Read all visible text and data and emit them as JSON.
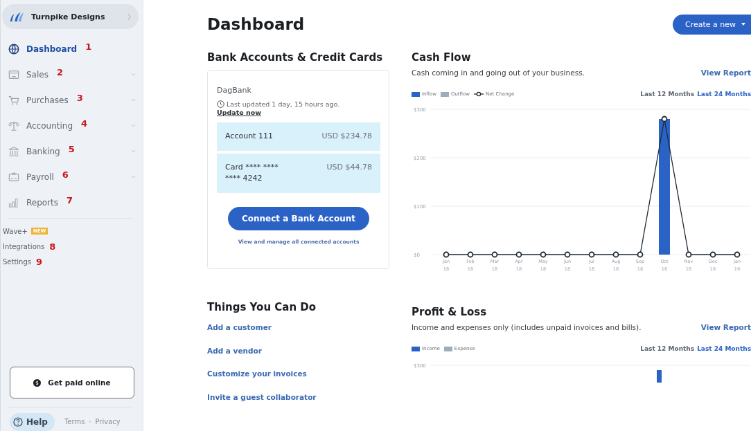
{
  "sidebar": {
    "business": {
      "name": "Turnpike Designs"
    },
    "items": [
      {
        "label": "Dashboard",
        "selected": true,
        "expandable": false,
        "annotation": "1"
      },
      {
        "label": "Sales",
        "selected": false,
        "expandable": true,
        "annotation": "2"
      },
      {
        "label": "Purchases",
        "selected": false,
        "expandable": true,
        "annotation": "3"
      },
      {
        "label": "Accounting",
        "selected": false,
        "expandable": true,
        "annotation": "4"
      },
      {
        "label": "Banking",
        "selected": false,
        "expandable": true,
        "annotation": "5"
      },
      {
        "label": "Payroll",
        "selected": false,
        "expandable": true,
        "annotation": "6"
      },
      {
        "label": "Reports",
        "selected": false,
        "expandable": false,
        "annotation": "7"
      }
    ],
    "links": [
      {
        "label": "Wave+",
        "badge": "NEW"
      },
      {
        "label": "Integrations",
        "annotation": "8"
      },
      {
        "label": "Settings",
        "annotation": "9"
      }
    ],
    "get_paid_button": "Get paid online",
    "footer": {
      "help": "Help",
      "terms": "Terms",
      "separator": "·",
      "privacy": "Privacy"
    }
  },
  "main": {
    "title": "Dashboard",
    "create_button": "Create a new",
    "bank_section": {
      "title": "Bank Accounts & Credit Cards",
      "bank_name": "DagBank",
      "last_updated": "Last updated 1 day, 15 hours ago.",
      "update_link": "Update now",
      "accounts": [
        {
          "name": "Account 111",
          "balance": "USD $234.78"
        },
        {
          "name": "Card **** **** **** 4242",
          "balance": "USD $44.78"
        }
      ],
      "connect_button": "Connect a Bank Account",
      "manage_link": "View and manage all connected accounts"
    },
    "things_section": {
      "title": "Things You Can Do",
      "links": [
        "Add a customer",
        "Add a vendor",
        "Customize your invoices",
        "Invite a guest collaborator"
      ]
    },
    "cash_flow": {
      "title": "Cash Flow",
      "subtitle": "Cash coming in and going out of your business.",
      "view_report": "View Report",
      "ranges": [
        {
          "label": "Last 12 Months",
          "selected": true
        },
        {
          "label": "Last 24 Months",
          "selected": false
        }
      ],
      "chart_data": {
        "type": "bar",
        "categories": [
          "Jan 18",
          "Feb 18",
          "Mar 18",
          "Apr 18",
          "May 18",
          "Jun 18",
          "Jul 18",
          "Aug 18",
          "Sep 18",
          "Oct 18",
          "Nov 18",
          "Dec 18",
          "Jan 19"
        ],
        "series": [
          {
            "name": "Inflow",
            "color": "#2a62c6",
            "values": [
              0,
              0,
              0,
              0,
              0,
              0,
              0,
              0,
              0,
              280,
              0,
              0,
              0
            ]
          },
          {
            "name": "Outflow",
            "color": "#9eadb9",
            "values": [
              0,
              0,
              0,
              0,
              0,
              0,
              0,
              0,
              0,
              0,
              0,
              0,
              0
            ]
          }
        ],
        "ylim": [
          0,
          300
        ],
        "yticks": [
          {
            "value": 0,
            "label": "$0"
          },
          {
            "value": 100,
            "label": "$100"
          },
          {
            "value": 200,
            "label": "$200"
          },
          {
            "value": 300,
            "label": "$300"
          }
        ]
      },
      "net_change_overlay": {
        "chart_data": {
          "type": "line",
          "series": [
            {
              "name": "Net Change",
              "color": "#1f2a36",
              "marker": true,
              "values": [
                0,
                0,
                0,
                0,
                0,
                0,
                0,
                0,
                0,
                280,
                0,
                0,
                0
              ]
            }
          ],
          "ylim": [
            0,
            300
          ]
        }
      }
    },
    "profit_loss": {
      "title": "Profit & Loss",
      "subtitle": "Income and expenses only (includes unpaid invoices and bills).",
      "view_report": "View Report",
      "ranges": [
        {
          "label": "Last 12 Months",
          "selected": true
        },
        {
          "label": "Last 24 Months",
          "selected": false
        }
      ],
      "legend": [
        {
          "name": "Income",
          "color": "#2a62c6"
        },
        {
          "name": "Expense",
          "color": "#9eadb9"
        }
      ],
      "y_tick": "$300"
    }
  }
}
